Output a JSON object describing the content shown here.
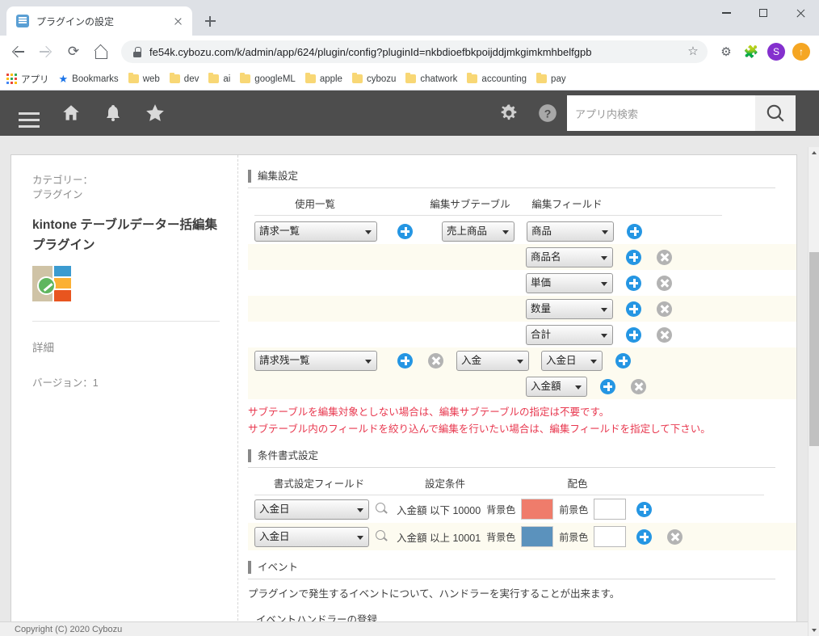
{
  "browser": {
    "tab": {
      "title": "プラグインの設定",
      "favicon": "document-icon",
      "close": "×"
    },
    "new_tab_label": "+",
    "window_controls": {
      "minimize": "−",
      "maximize": "□",
      "close": "×"
    },
    "url": "fe54k.cybozu.com/k/admin/app/624/plugin/config?pluginId=nkbdioefbkpoijddjmkgimkmhbelfgpb",
    "nav": {
      "back": "←",
      "forward": "→",
      "reload": "⟳",
      "home": "⌂"
    },
    "toolbar_icons": [
      "star-icon",
      "gear-icon",
      "extensions-icon",
      "profile-avatar",
      "update-icon"
    ],
    "avatar_letter": "S",
    "update_glyph": "↑",
    "bookmarks": [
      {
        "label": "アプリ",
        "icon": "apps-grid-icon"
      },
      {
        "label": "Bookmarks",
        "icon": "star-icon"
      },
      {
        "label": "web",
        "icon": "folder-icon"
      },
      {
        "label": "dev",
        "icon": "folder-icon"
      },
      {
        "label": "ai",
        "icon": "folder-icon"
      },
      {
        "label": "googleML",
        "icon": "folder-icon"
      },
      {
        "label": "apple",
        "icon": "folder-icon"
      },
      {
        "label": "cybozu",
        "icon": "folder-icon"
      },
      {
        "label": "chatwork",
        "icon": "folder-icon"
      },
      {
        "label": "accounting",
        "icon": "folder-icon"
      },
      {
        "label": "pay",
        "icon": "folder-icon"
      }
    ]
  },
  "kintone_header": {
    "icons": [
      "hamburger-icon",
      "home-icon",
      "bell-icon",
      "star-icon"
    ],
    "gear": "⚙",
    "help": "?",
    "search_placeholder": "アプリ内検索",
    "search_value": "",
    "search_button": "search-icon"
  },
  "sidebar": {
    "category_label": "カテゴリー：",
    "category_value": "プラグイン",
    "plugin_title": "kintone テーブルデーター括編集プラグイン",
    "plugin_icon": "plugin-logo-icon",
    "detail_label": "詳細",
    "version_label": "バージョン：1"
  },
  "edit_settings": {
    "section_title": "編集設定",
    "columns": {
      "list": "使用一覧",
      "subtable": "編集サブテーブル",
      "field": "編集フィールド"
    },
    "groups": [
      {
        "list": "請求一覧",
        "subtable": "売上商品",
        "has_group_delete": false,
        "fields": [
          {
            "value": "商品",
            "has_delete": false,
            "shaded": false
          },
          {
            "value": "商品名",
            "has_delete": true,
            "shaded": true
          },
          {
            "value": "単価",
            "has_delete": true,
            "shaded": false
          },
          {
            "value": "数量",
            "has_delete": true,
            "shaded": true
          },
          {
            "value": "合計",
            "has_delete": true,
            "shaded": false
          }
        ]
      },
      {
        "list": "請求残一覧",
        "subtable": "入金",
        "has_group_delete": true,
        "fields": [
          {
            "value": "入金日",
            "has_delete": false,
            "shaded": true
          },
          {
            "value": "入金額",
            "has_delete": true,
            "shaded": true
          }
        ]
      }
    ],
    "warnings": [
      "サブテーブルを編集対象としない場合は、編集サブテーブルの指定は不要です。",
      "サブテーブル内のフィールドを絞り込んで編集を行いたい場合は、編集フィールドを指定して下さい。"
    ]
  },
  "conditional_format": {
    "section_title": "条件書式設定",
    "columns": {
      "field": "書式設定フィールド",
      "condition": "設定条件",
      "colors": "配色"
    },
    "bg_label": "背景色",
    "fg_label": "前景色",
    "search_icon": "magnifier-icon",
    "rows": [
      {
        "field": "入金日",
        "condition": "入金額 以下 10000",
        "bg_color": "#ef7c6b",
        "fg_color": "",
        "has_delete": false,
        "shaded": false
      },
      {
        "field": "入金日",
        "condition": "入金額 以上 10001",
        "bg_color": "#5b92bd",
        "fg_color": "",
        "has_delete": true,
        "shaded": true
      }
    ]
  },
  "event_section": {
    "section_title": "イベント",
    "description": "プラグインで発生するイベントについて、ハンドラーを実行することが出来ます。",
    "subsection": "イベントハンドラーの登録"
  },
  "footer": {
    "copyright": "Copyright (C) 2020 Cybozu"
  }
}
